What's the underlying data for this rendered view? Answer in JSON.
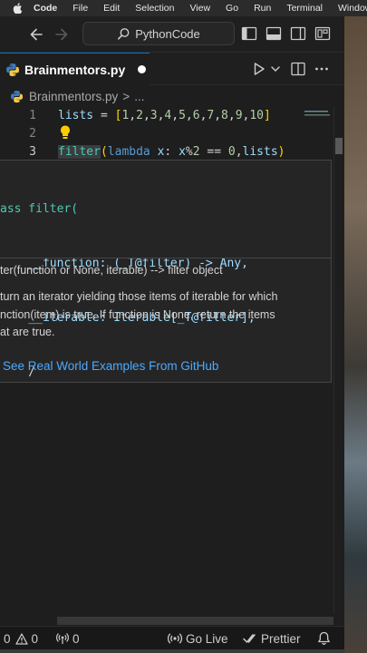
{
  "menubar": {
    "app": "Code",
    "items": [
      "File",
      "Edit",
      "Selection",
      "View",
      "Go",
      "Run",
      "Terminal",
      "Window"
    ]
  },
  "titlebar": {
    "search_text": "PythonCode"
  },
  "tab": {
    "label": "Brainmentors.py",
    "modified": true
  },
  "breadcrumb": {
    "file": "Brainmentors.py",
    "separator": ">",
    "ellipsis": "..."
  },
  "editor": {
    "lines": [
      {
        "number": "1",
        "text": "lists = [1,2,3,4,5,6,7,8,9,10]"
      },
      {
        "number": "2",
        "text": ""
      },
      {
        "number": "3",
        "text": "filter(lambda x: x%2 == 0,lists)"
      }
    ]
  },
  "hover": {
    "signature": [
      "ass filter(",
      "    __function: (_T@filter) -> Any,",
      "    __iterable: Iterable[_T@filter],",
      "    /"
    ],
    "doc_header": "ter(function or None, iterable) --> filter object",
    "doc_body": [
      "turn an iterator yielding those items of iterable for which",
      "nction(item) is true. If function is None, return the items",
      "at are true."
    ],
    "link": "See Real World Examples From GitHub"
  },
  "statusbar": {
    "errors": "0",
    "warnings": "0",
    "ports": "0",
    "go_live": "Go Live",
    "prettier": "Prettier"
  },
  "colors": {
    "accent": "#0078d4",
    "link": "#4daafc",
    "keyword": "#569cd6",
    "type": "#4ec9b0",
    "number": "#b5cea8"
  }
}
